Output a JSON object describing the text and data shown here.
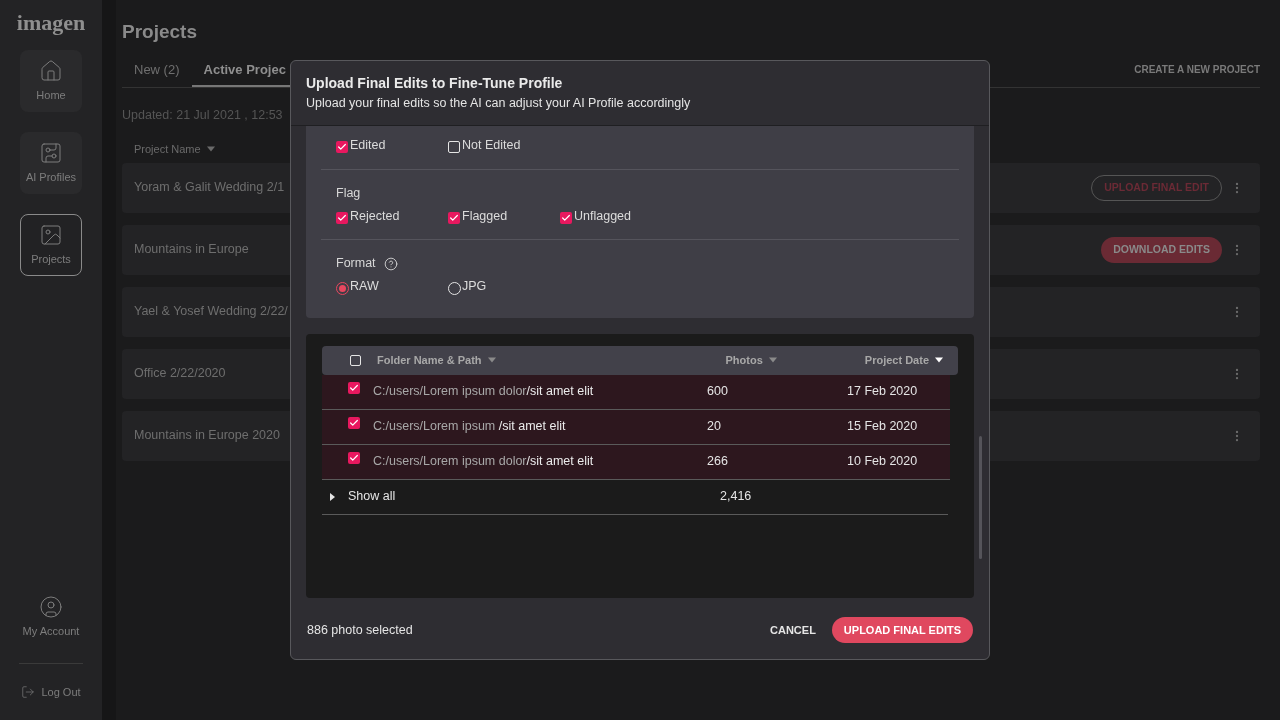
{
  "sidebar": {
    "logo": "imagen",
    "items": [
      {
        "label": "Home",
        "selected": false
      },
      {
        "label": "AI Profiles",
        "selected": false
      },
      {
        "label": "Projects",
        "selected": true
      }
    ],
    "account": "My Account",
    "logout": "Log Out"
  },
  "page": {
    "title": "Projects",
    "tabs": [
      {
        "label": "New (2)",
        "selected": false
      },
      {
        "label": "Active Projec",
        "selected": true
      }
    ],
    "create": "CREATE A NEW PROJECT",
    "updated": "Updated: 21 Jul 2021 , 12:53",
    "column": "Project Name",
    "rows": [
      {
        "name": "Yoram & Galit Wedding 2/1",
        "action": {
          "kind": "outline",
          "label": "UPLOAD FINAL EDIT"
        }
      },
      {
        "name": "Mountains in Europe",
        "action": {
          "kind": "filled",
          "label": "DOWNLOAD EDITS"
        }
      },
      {
        "name": "Yael & Yosef Wedding 2/22/"
      },
      {
        "name": "Office 2/22/2020"
      },
      {
        "name": "Mountains in Europe 2020"
      }
    ]
  },
  "modal": {
    "title": "Upload Final Edits to Fine-Tune Profile",
    "subtitle": "Upload your final edits so the AI can adjust your AI Profile accordingly",
    "filters": [
      {
        "kind": "checkbox",
        "options": [
          {
            "label": "Edited",
            "checked": true
          },
          {
            "label": "Not Edited",
            "checked": false
          }
        ]
      },
      {
        "kind": "checkbox",
        "label": "Flag",
        "options": [
          {
            "label": "Rejected",
            "checked": true
          },
          {
            "label": "Flagged",
            "checked": true
          },
          {
            "label": "Unflagged",
            "checked": true
          }
        ]
      },
      {
        "kind": "radio",
        "label": "Format",
        "help": true,
        "options": [
          {
            "label": "RAW",
            "selected": true
          },
          {
            "label": "JPG",
            "selected": false
          }
        ]
      }
    ],
    "table": {
      "checked": false,
      "columns": [
        "Folder Name & Path",
        "Photos",
        "Project Date"
      ],
      "rows": [
        {
          "checked": true,
          "path": "C:/users/Lorem ipsum dolor",
          "folder": "/sit amet elit",
          "photos": "600",
          "date": "17 Feb 2020"
        },
        {
          "checked": true,
          "path": "C:/users/Lorem ipsum ",
          "folder": "/sit amet elit",
          "photos": "20",
          "date": "15 Feb 2020"
        },
        {
          "checked": true,
          "path": "C:/users/Lorem ipsum dolor",
          "folder": "/sit amet elit",
          "photos": "266",
          "date": "10 Feb 2020"
        }
      ],
      "show_all": {
        "label": "Show all",
        "count": "2,416",
        "expanded": false
      }
    },
    "selected": "886 photo selected",
    "cancel": "CANCEL",
    "submit": "UPLOAD FINAL EDITS"
  }
}
